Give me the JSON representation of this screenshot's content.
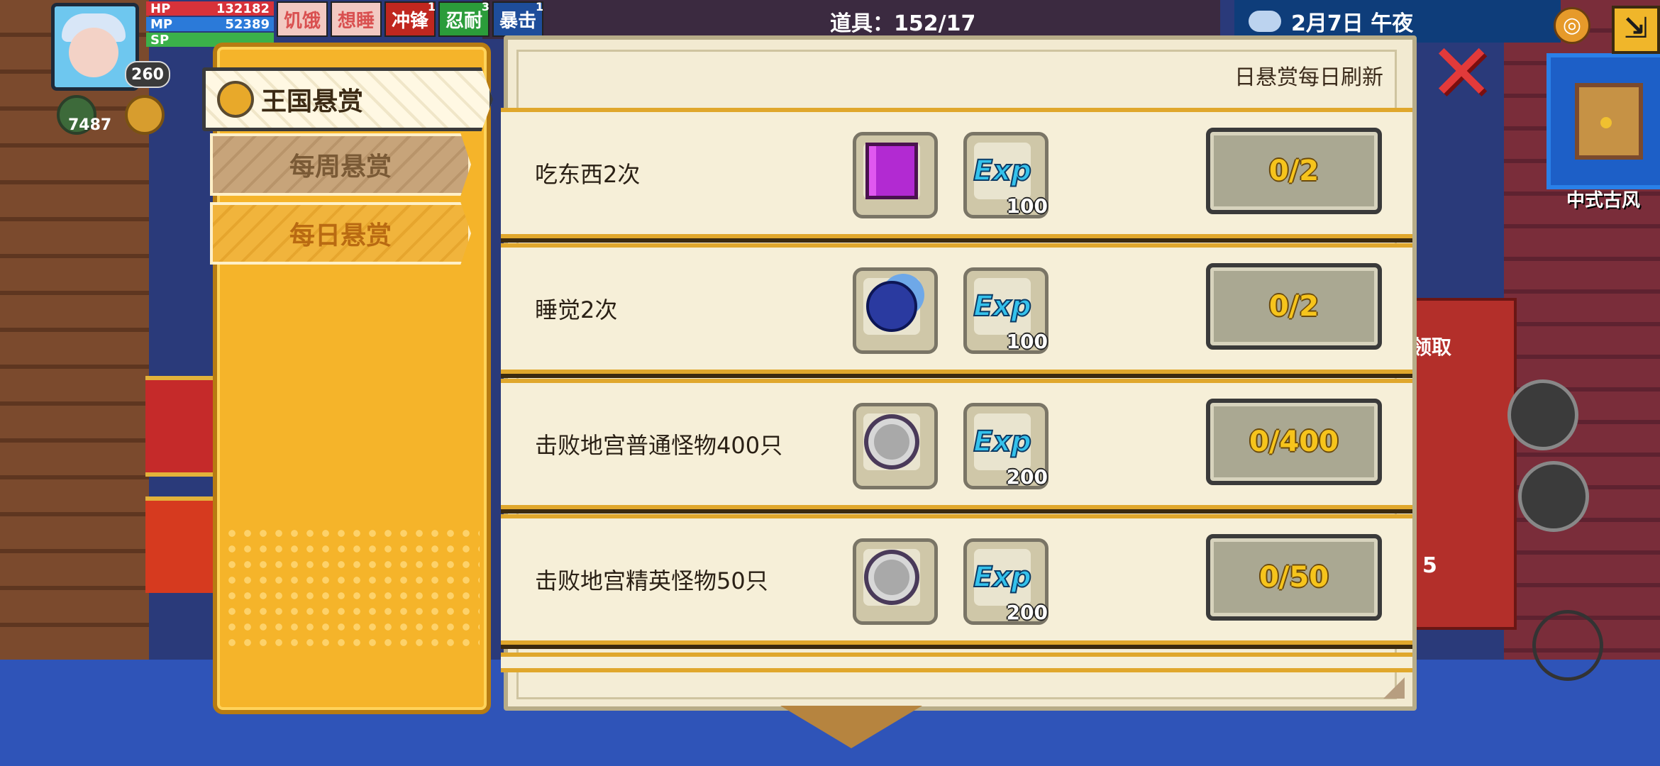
{
  "hud": {
    "hp_label": "HP",
    "hp_value": "132182",
    "mp_label": "MP",
    "mp_value": "52389",
    "sp_label": "SP",
    "level": "260",
    "gem_count": "7487",
    "buffs": [
      {
        "label": "饥饿",
        "sup": ""
      },
      {
        "label": "想睡",
        "sup": ""
      },
      {
        "label": "冲锋",
        "sup": "1"
      },
      {
        "label": "忍耐",
        "sup": "3"
      },
      {
        "label": "暴击",
        "sup": "1"
      }
    ],
    "item_count": "道具：152/17",
    "date_time": "2月7日  午夜",
    "minimap_label": "中式古风",
    "claim_label": "领取",
    "side_number": "5"
  },
  "tabs": {
    "kingdom": "王国悬赏",
    "weekly": "每周悬赏",
    "daily": "每日悬赏"
  },
  "panel": {
    "refresh_note": "日悬赏每日刷新"
  },
  "tasks": [
    {
      "name": "吃东西2次",
      "exp": "100",
      "progress": "0/2"
    },
    {
      "name": "睡觉2次",
      "exp": "100",
      "progress": "0/2"
    },
    {
      "name": "击败地宫普通怪物400只",
      "exp": "200",
      "progress": "0/400"
    },
    {
      "name": "击败地宫精英怪物50只",
      "exp": "200",
      "progress": "0/50"
    }
  ],
  "exp_label": "Exp",
  "colors": {
    "tab_panel": "#f5b42a",
    "paper": "#f2ead1",
    "progress_text": "#f6c41c",
    "close": "#e23a3a",
    "exp_text": "#34c2ec"
  }
}
